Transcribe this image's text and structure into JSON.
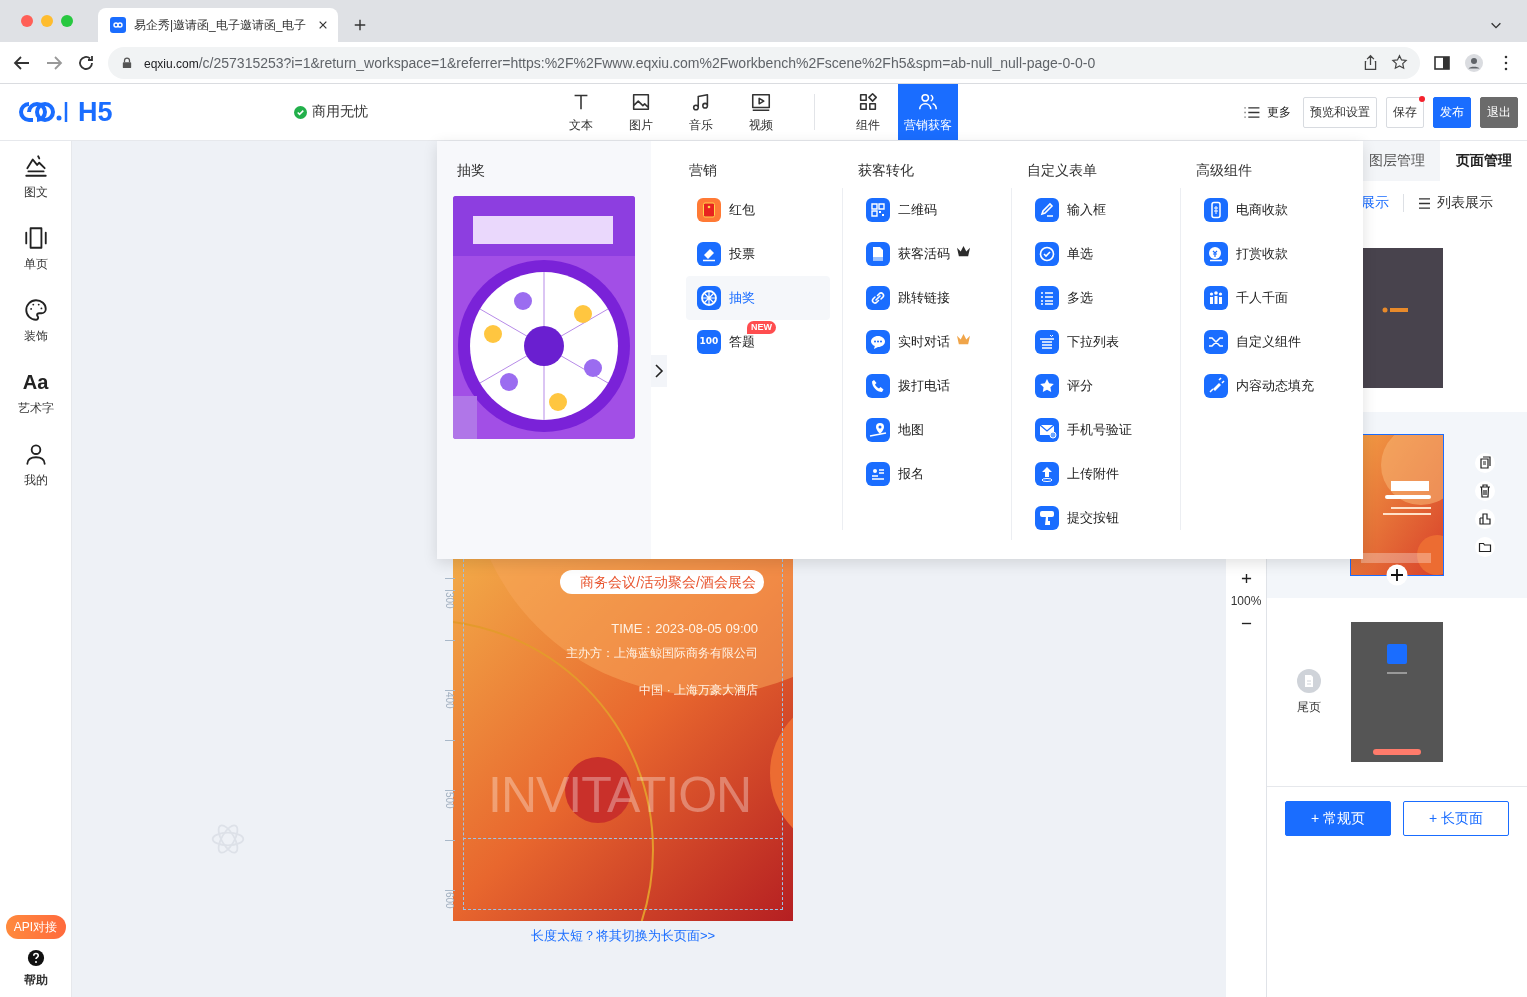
{
  "browser": {
    "tab_title": "易企秀|邀请函_电子邀请函_电子",
    "url_host": "eqxiu.com",
    "url_path": "/c/257315253?i=1&return_workspace=1&referrer=https:%2F%2Fwww.eqxiu.com%2Fworkbench%2Fscene%2Fh5&spm=ab-null_null-page-0-0-0"
  },
  "header": {
    "logo": "H5",
    "license": "商用无忧",
    "tool_groups": [
      [
        {
          "label": "文本",
          "selected": false
        },
        {
          "label": "图片",
          "selected": false
        },
        {
          "label": "音乐",
          "selected": false
        },
        {
          "label": "视频",
          "selected": false
        }
      ],
      [
        {
          "label": "组件",
          "selected": false
        },
        {
          "label": "营销获客",
          "selected": true
        }
      ]
    ],
    "more": "更多",
    "preview": "预览和设置",
    "save": "保存",
    "unsaved": true,
    "publish": "发布",
    "exit": "退出"
  },
  "sidebar": {
    "items": [
      {
        "label": "图文"
      },
      {
        "label": "单页"
      },
      {
        "label": "装饰"
      },
      {
        "label": "艺术字",
        "glyph": "Aa"
      },
      {
        "label": "我的"
      }
    ],
    "api": "API对接",
    "help": "帮助"
  },
  "dropdown": {
    "feature_title": "抽奖",
    "columns": [
      {
        "title": "营销",
        "items": [
          {
            "label": "红包",
            "selected": false
          },
          {
            "label": "投票",
            "selected": false
          },
          {
            "label": "抽奖",
            "selected": true
          },
          {
            "label": "答题",
            "selected": false,
            "icon_text": "100",
            "badge": "NEW"
          }
        ]
      },
      {
        "title": "获客转化",
        "items": [
          {
            "label": "二维码",
            "selected": false
          },
          {
            "label": "获客活码",
            "selected": false,
            "crown": true,
            "gold": false
          },
          {
            "label": "跳转链接",
            "selected": false
          },
          {
            "label": "实时对话",
            "selected": false,
            "crown": true,
            "gold": true
          },
          {
            "label": "拨打电话",
            "selected": false
          },
          {
            "label": "地图",
            "selected": false
          },
          {
            "label": "报名",
            "selected": false
          }
        ]
      },
      {
        "title": "自定义表单",
        "items": [
          {
            "label": "输入框",
            "selected": false
          },
          {
            "label": "单选",
            "selected": false
          },
          {
            "label": "多选",
            "selected": false
          },
          {
            "label": "下拉列表",
            "selected": false
          },
          {
            "label": "评分",
            "selected": false
          },
          {
            "label": "手机号验证",
            "selected": false
          },
          {
            "label": "上传附件",
            "selected": false
          },
          {
            "label": "提交按钮",
            "selected": false
          }
        ]
      },
      {
        "title": "高级组件",
        "items": [
          {
            "label": "电商收款",
            "selected": false
          },
          {
            "label": "打赏收款",
            "selected": false
          },
          {
            "label": "千人千面",
            "selected": false
          },
          {
            "label": "自定义组件",
            "selected": false
          },
          {
            "label": "内容动态填充",
            "selected": false
          }
        ]
      }
    ]
  },
  "canvas": {
    "ruler": [
      "300",
      "400",
      "500",
      "600"
    ],
    "poster": {
      "tagline": "商务会议/活动聚会/酒会展会",
      "time": "TIME：2023-08-05  09:00",
      "host": "主办方：上海蓝鲸国际商务有限公司",
      "venue": "中国 · 上海万豪大酒店",
      "watermark": "INVITATION"
    },
    "switch_link": "长度太短？将其切换为长页面>>",
    "zoom": "100%"
  },
  "panel": {
    "tabs": [
      {
        "label": "图层管理",
        "selected": false
      },
      {
        "label": "页面管理",
        "selected": true
      }
    ],
    "views": [
      {
        "label": "展示",
        "selected": true
      },
      {
        "label": "列表展示",
        "selected": false
      }
    ],
    "pages": [
      {
        "kind": "cover",
        "selected": false
      },
      {
        "kind": "invitation",
        "selected": true
      },
      {
        "kind": "end",
        "selected": false,
        "label": "尾页"
      }
    ],
    "add_page": "+ 常规页",
    "add_long": "+ 长页面"
  }
}
